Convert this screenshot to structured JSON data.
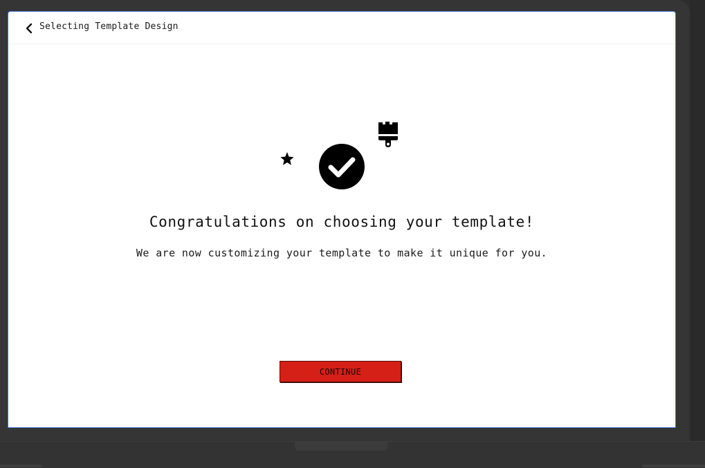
{
  "header": {
    "title": "Selecting Template Design",
    "back_icon": "chevron-left-icon"
  },
  "illustration": {
    "icons": [
      "star-icon",
      "check-circle-icon",
      "paint-brush-icon"
    ],
    "color": "#000000"
  },
  "main": {
    "headline": "Congratulations on choosing your template!",
    "subline": "We are now customizing your template to make it unique for you."
  },
  "actions": {
    "continue_label": "CONTINUE",
    "continue_color": "#d42016"
  },
  "frame": {
    "bezel_color": "#353535",
    "screen_border_color": "#3d7bd8"
  }
}
